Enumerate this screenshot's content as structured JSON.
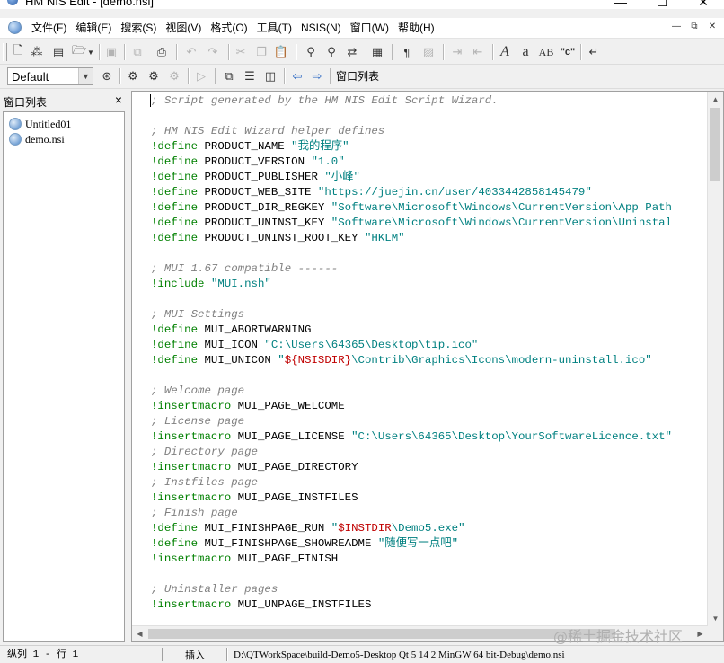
{
  "window": {
    "title": "HM NIS Edit - [demo.nsi]",
    "minimize": "—",
    "maximize": "☐",
    "close": "✕"
  },
  "menu": {
    "items": [
      "文件(F)",
      "编辑(E)",
      "搜索(S)",
      "视图(V)",
      "格式(O)",
      "工具(T)",
      "NSIS(N)",
      "窗口(W)",
      "帮助(H)"
    ],
    "mdi_min": "—",
    "mdi_restore": "⧉",
    "mdi_close": "✕"
  },
  "toolbar": {
    "font_combo_value": "Default",
    "window_list_button": "窗口列表"
  },
  "panel": {
    "title": "窗口列表",
    "close": "×",
    "files": [
      "Untitled01",
      "demo.nsi"
    ]
  },
  "editor": {
    "lines": [
      [
        {
          "t": "; Script generated by the HM NIS Edit Script Wizard.",
          "c": "comment"
        }
      ],
      [],
      [
        {
          "t": "; HM NIS Edit Wizard helper defines",
          "c": "comment"
        }
      ],
      [
        {
          "t": "!define",
          "c": "kw"
        },
        {
          "t": " PRODUCT_NAME ",
          "c": "plain"
        },
        {
          "t": "\"我的程序\"",
          "c": "str"
        }
      ],
      [
        {
          "t": "!define",
          "c": "kw"
        },
        {
          "t": " PRODUCT_VERSION ",
          "c": "plain"
        },
        {
          "t": "\"1.0\"",
          "c": "str"
        }
      ],
      [
        {
          "t": "!define",
          "c": "kw"
        },
        {
          "t": " PRODUCT_PUBLISHER ",
          "c": "plain"
        },
        {
          "t": "\"小峰\"",
          "c": "str"
        }
      ],
      [
        {
          "t": "!define",
          "c": "kw"
        },
        {
          "t": " PRODUCT_WEB_SITE ",
          "c": "plain"
        },
        {
          "t": "\"https://juejin.cn/user/4033442858145479\"",
          "c": "str"
        }
      ],
      [
        {
          "t": "!define",
          "c": "kw"
        },
        {
          "t": " PRODUCT_DIR_REGKEY ",
          "c": "plain"
        },
        {
          "t": "\"Software\\Microsoft\\Windows\\CurrentVersion\\App Path",
          "c": "str"
        }
      ],
      [
        {
          "t": "!define",
          "c": "kw"
        },
        {
          "t": " PRODUCT_UNINST_KEY ",
          "c": "plain"
        },
        {
          "t": "\"Software\\Microsoft\\Windows\\CurrentVersion\\Uninstal",
          "c": "str"
        }
      ],
      [
        {
          "t": "!define",
          "c": "kw"
        },
        {
          "t": " PRODUCT_UNINST_ROOT_KEY ",
          "c": "plain"
        },
        {
          "t": "\"HKLM\"",
          "c": "str"
        }
      ],
      [],
      [
        {
          "t": "; MUI 1.67 compatible ------",
          "c": "comment"
        }
      ],
      [
        {
          "t": "!include",
          "c": "kw"
        },
        {
          "t": " ",
          "c": "plain"
        },
        {
          "t": "\"MUI.nsh\"",
          "c": "str"
        }
      ],
      [],
      [
        {
          "t": "; MUI Settings",
          "c": "comment"
        }
      ],
      [
        {
          "t": "!define",
          "c": "kw"
        },
        {
          "t": " MUI_ABORTWARNING",
          "c": "plain"
        }
      ],
      [
        {
          "t": "!define",
          "c": "kw"
        },
        {
          "t": " MUI_ICON ",
          "c": "plain"
        },
        {
          "t": "\"C:\\Users\\64365\\Desktop\\tip.ico\"",
          "c": "str"
        }
      ],
      [
        {
          "t": "!define",
          "c": "kw"
        },
        {
          "t": " MUI_UNICON ",
          "c": "plain"
        },
        {
          "t": "\"",
          "c": "str"
        },
        {
          "t": "${NSISDIR}",
          "c": "var"
        },
        {
          "t": "\\Contrib\\Graphics\\Icons\\modern-uninstall.ico\"",
          "c": "str"
        }
      ],
      [],
      [
        {
          "t": "; Welcome page",
          "c": "comment"
        }
      ],
      [
        {
          "t": "!insertmacro",
          "c": "kw"
        },
        {
          "t": " MUI_PAGE_WELCOME",
          "c": "plain"
        }
      ],
      [
        {
          "t": "; License page",
          "c": "comment"
        }
      ],
      [
        {
          "t": "!insertmacro",
          "c": "kw"
        },
        {
          "t": " MUI_PAGE_LICENSE ",
          "c": "plain"
        },
        {
          "t": "\"C:\\Users\\64365\\Desktop\\YourSoftwareLicence.txt\"",
          "c": "str"
        }
      ],
      [
        {
          "t": "; Directory page",
          "c": "comment"
        }
      ],
      [
        {
          "t": "!insertmacro",
          "c": "kw"
        },
        {
          "t": " MUI_PAGE_DIRECTORY",
          "c": "plain"
        }
      ],
      [
        {
          "t": "; Instfiles page",
          "c": "comment"
        }
      ],
      [
        {
          "t": "!insertmacro",
          "c": "kw"
        },
        {
          "t": " MUI_PAGE_INSTFILES",
          "c": "plain"
        }
      ],
      [
        {
          "t": "; Finish page",
          "c": "comment"
        }
      ],
      [
        {
          "t": "!define",
          "c": "kw"
        },
        {
          "t": " MUI_FINISHPAGE_RUN ",
          "c": "plain"
        },
        {
          "t": "\"",
          "c": "str"
        },
        {
          "t": "$INSTDIR",
          "c": "var"
        },
        {
          "t": "\\Demo5.exe\"",
          "c": "str"
        }
      ],
      [
        {
          "t": "!define",
          "c": "kw"
        },
        {
          "t": " MUI_FINISHPAGE_SHOWREADME ",
          "c": "plain"
        },
        {
          "t": "\"随便写一点吧\"",
          "c": "str"
        }
      ],
      [
        {
          "t": "!insertmacro",
          "c": "kw"
        },
        {
          "t": " MUI_PAGE_FINISH",
          "c": "plain"
        }
      ],
      [],
      [
        {
          "t": "; Uninstaller pages",
          "c": "comment"
        }
      ],
      [
        {
          "t": "!insertmacro",
          "c": "kw"
        },
        {
          "t": " MUI_UNPAGE_INSTFILES",
          "c": "plain"
        }
      ]
    ]
  },
  "watermark": "@稀土掘金技术社区",
  "status": {
    "position": "纵列 1 - 行 1",
    "mode": "插入",
    "path": "D:\\QTWorkSpace\\build-Demo5-Desktop Qt 5 14 2 MinGW 64 bit-Debug\\demo.nsi"
  },
  "colors": {
    "keyword": "#008000",
    "string": "#008080",
    "comment": "#808080",
    "variable": "#c00000"
  },
  "icons": [
    "new-file-icon",
    "wizard-icon",
    "template-icon",
    "open-folder-icon",
    "save-icon",
    "save-all-icon",
    "print-icon",
    "undo-icon",
    "redo-icon",
    "cut-icon",
    "copy-icon",
    "paste-icon",
    "find-icon",
    "find-next-icon",
    "replace-icon",
    "insert-file-icon",
    "paragraph-icon",
    "show-whitespace-icon",
    "indent-icon",
    "outdent-icon",
    "uppercase-icon",
    "lowercase-icon",
    "proper-case-icon",
    "quote-icon",
    "word-wrap-icon"
  ]
}
